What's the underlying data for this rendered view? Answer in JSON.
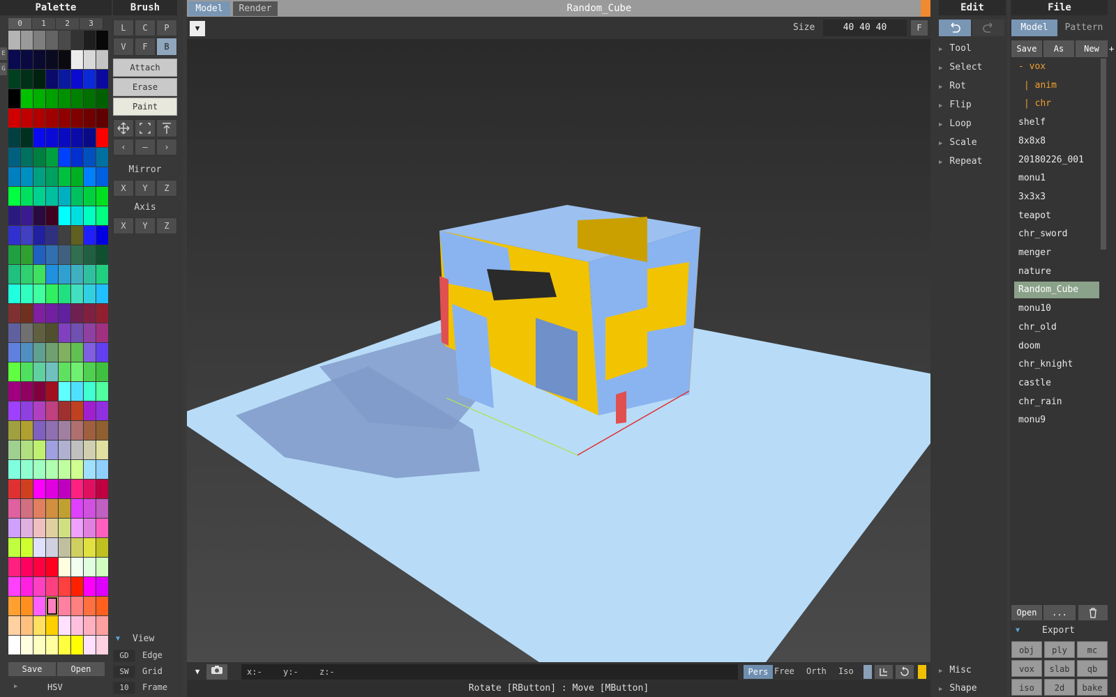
{
  "palette": {
    "title": "Palette",
    "tabs": [
      "0",
      "1",
      "2",
      "3"
    ],
    "side_letters": [
      "E",
      "G"
    ],
    "save_label": "Save",
    "open_label": "Open",
    "hsv_label": "HSV",
    "swatches": [
      "#b4b4b4",
      "#9a9a9a",
      "#7e7e7e",
      "#646464",
      "#4a4a4a",
      "#333333",
      "#1e1e1e",
      "#080808",
      "#0a0a50",
      "#0a0a40",
      "#0a0a30",
      "#0a0a20",
      "#0a0a10",
      "#ececec",
      "#d8d8d8",
      "#c4c4c4",
      "#004020",
      "#003018",
      "#002010",
      "#0a0a6a",
      "#0a1aa0",
      "#0a0ad0",
      "#0a2ad8",
      "#0a0aa0",
      "#000000",
      "#00c000",
      "#00b000",
      "#00a000",
      "#009000",
      "#008000",
      "#007000",
      "#006000",
      "#d00000",
      "#c00000",
      "#b00000",
      "#a00000",
      "#900000",
      "#800000",
      "#700000",
      "#600000",
      "#004040",
      "#003020",
      "#0a0af0",
      "#0a0ad8",
      "#0a0ac0",
      "#0a0aa8",
      "#0a0a88",
      "#ff0000",
      "#006080",
      "#007060",
      "#008040",
      "#00a040",
      "#0040ff",
      "#0030d0",
      "#0050c0",
      "#0070a0",
      "#0080c0",
      "#0090c0",
      "#00a080",
      "#00a060",
      "#00c040",
      "#00b020",
      "#0080ff",
      "#0060e0",
      "#00ff40",
      "#00e060",
      "#00d090",
      "#00c0a0",
      "#00b0c0",
      "#00c060",
      "#00d040",
      "#00e020",
      "#2a1a80",
      "#3a1a90",
      "#2a0a40",
      "#400020",
      "#00ffff",
      "#00e0e0",
      "#00ffc0",
      "#00ff80",
      "#3030d0",
      "#4040c0",
      "#2020a0",
      "#303080",
      "#404040",
      "#606020",
      "#2020ff",
      "#0000e0",
      "#20a040",
      "#30a030",
      "#2060c0",
      "#3070b0",
      "#406080",
      "#307050",
      "#206040",
      "#105030",
      "#20c080",
      "#30d070",
      "#40e060",
      "#2090e0",
      "#30a0d0",
      "#40b0c0",
      "#30c0a0",
      "#20d080",
      "#20ffe0",
      "#30ffc0",
      "#40ffa0",
      "#30f060",
      "#20e080",
      "#40e0c0",
      "#30d0e0",
      "#20c0ff",
      "#803030",
      "#703020",
      "#8020a0",
      "#7020a0",
      "#6020a0",
      "#702050",
      "#802040",
      "#902030",
      "#6060a0",
      "#707070",
      "#606040",
      "#505030",
      "#8040c0",
      "#7050b0",
      "#9040a0",
      "#a03080",
      "#6080e0",
      "#5090c0",
      "#60a090",
      "#70a070",
      "#80b060",
      "#60c050",
      "#8060e0",
      "#6040f0",
      "#60ff40",
      "#50e060",
      "#60d0a0",
      "#70c0c0",
      "#60e060",
      "#70f070",
      "#50d050",
      "#40c040",
      "#a00080",
      "#900060",
      "#800040",
      "#a01020",
      "#60ffff",
      "#50e0ff",
      "#40ffd0",
      "#50ffa0",
      "#a040ff",
      "#9040e0",
      "#b040c0",
      "#c04080",
      "#a03030",
      "#c04020",
      "#a020d0",
      "#9030e0",
      "#a0a040",
      "#b0a030",
      "#8060c0",
      "#9070b0",
      "#a080a0",
      "#b07070",
      "#a06040",
      "#906030",
      "#a0d090",
      "#b0e080",
      "#c0f070",
      "#a0a0e0",
      "#b0b0d0",
      "#c0c0c0",
      "#d0d0b0",
      "#e0e0a0",
      "#80ffe0",
      "#90ffd0",
      "#a0ffc0",
      "#b0ffb0",
      "#c0ffa0",
      "#d0ff90",
      "#a0e0ff",
      "#90d0ff",
      "#e03030",
      "#d04020",
      "#ff00ff",
      "#e000e0",
      "#c000c0",
      "#ff2080",
      "#e01060",
      "#c00040",
      "#e060a0",
      "#d07080",
      "#e08060",
      "#d09040",
      "#c0a030",
      "#e040ff",
      "#d050e0",
      "#c060c0",
      "#d0a0ff",
      "#e0b0e0",
      "#f0c0c0",
      "#e0d0a0",
      "#d0e080",
      "#f0a0ff",
      "#e080e0",
      "#ff60c0",
      "#c0ff40",
      "#d0ff30",
      "#e0e0ff",
      "#d0d0e0",
      "#c0c0a0",
      "#d0d060",
      "#e0e040",
      "#c0c020",
      "#ff2080",
      "#ff0060",
      "#ff0040",
      "#ff0020",
      "#ffffe0",
      "#f0fff0",
      "#e0ffe0",
      "#d0ffc0",
      "#ff40ff",
      "#ff20e0",
      "#ff40c0",
      "#ff4080",
      "#ff4040",
      "#ff2000",
      "#ff00ff",
      "#e000ff",
      "#ffa030",
      "#ff9020",
      "#ff60ff",
      "#ff80c0",
      "#ff80a0",
      "#ff8080",
      "#ff7040",
      "#ff6020",
      "#ffd0a0",
      "#ffc080",
      "#ffe060",
      "#ffd000",
      "#ffe0ff",
      "#ffc0e0",
      "#ffb0c0",
      "#ffa0a0",
      "#ffffff",
      "#ffffe0",
      "#ffffc0",
      "#ffffa0",
      "#ffff40",
      "#ffff00",
      "#ffe0ff",
      "#ffd0e0"
    ],
    "selected_index": 235
  },
  "brush": {
    "title": "Brush",
    "shape_buttons": [
      [
        "L",
        "C",
        "P"
      ],
      [
        "V",
        "F",
        "B"
      ]
    ],
    "active_shape": "B",
    "mode_buttons": [
      "Attach",
      "Erase",
      "Paint"
    ],
    "mirror_label": "Mirror",
    "axis_label": "Axis",
    "xyz": [
      "X",
      "Y",
      "Z"
    ],
    "view_label": "View",
    "view_rows": [
      {
        "key": "GD",
        "label": "Edge"
      },
      {
        "key": "SW",
        "label": "Grid"
      },
      {
        "key": "10",
        "label": "Frame"
      }
    ]
  },
  "viewport": {
    "tab_model": "Model",
    "tab_render": "Render",
    "title": "Random_Cube",
    "size_label": "Size",
    "size_value": "40 40 40",
    "f_label": "F",
    "coords": [
      "x:-",
      "y:-",
      "z:-"
    ],
    "cam_modes": [
      "Pers",
      "Free",
      "Orth",
      "Iso"
    ],
    "active_cam": "Pers",
    "status": "Rotate [RButton] : Move [MButton]"
  },
  "edit": {
    "title": "Edit",
    "items": [
      "Tool",
      "Select",
      "Rot",
      "Flip",
      "Loop",
      "Scale",
      "Repeat"
    ],
    "bottom_items": [
      "Misc",
      "Shape"
    ]
  },
  "file": {
    "title": "File",
    "tabs": [
      "Model",
      "Pattern"
    ],
    "actions": [
      "Save",
      "As",
      "New",
      "+"
    ],
    "tree": [
      {
        "label": "- vox",
        "kind": "orange"
      },
      {
        "label": "| anim",
        "kind": "orange"
      },
      {
        "label": "| chr",
        "kind": "orange"
      },
      {
        "label": "shelf",
        "kind": ""
      },
      {
        "label": "8x8x8",
        "kind": ""
      },
      {
        "label": "20180226_001",
        "kind": ""
      },
      {
        "label": "monu1",
        "kind": ""
      },
      {
        "label": "3x3x3",
        "kind": ""
      },
      {
        "label": "teapot",
        "kind": ""
      },
      {
        "label": "chr_sword",
        "kind": ""
      },
      {
        "label": "menger",
        "kind": ""
      },
      {
        "label": "nature",
        "kind": ""
      },
      {
        "label": "Random_Cube",
        "kind": "selected"
      },
      {
        "label": "monu10",
        "kind": ""
      },
      {
        "label": "chr_old",
        "kind": ""
      },
      {
        "label": "doom",
        "kind": ""
      },
      {
        "label": "chr_knight",
        "kind": ""
      },
      {
        "label": "castle",
        "kind": ""
      },
      {
        "label": "chr_rain",
        "kind": ""
      },
      {
        "label": "monu9",
        "kind": ""
      }
    ],
    "open_label": "Open",
    "more_label": "...",
    "export_label": "Export",
    "export_formats": [
      "obj",
      "ply",
      "mc",
      "vox",
      "slab",
      "qb",
      "iso",
      "2d",
      "bake"
    ]
  },
  "colors": {
    "accent_blue": "#6f8fb0",
    "selected_green": "#8ba28a",
    "tree_orange": "#f0a030",
    "floor": "#b8dcf8",
    "voxel_blue": "#8ab4f0",
    "voxel_yellow": "#f0c000"
  }
}
